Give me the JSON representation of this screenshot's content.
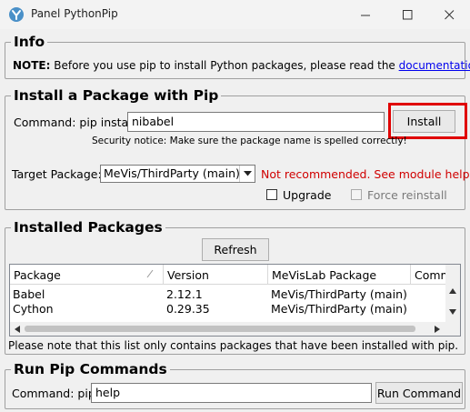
{
  "window": {
    "title": "Panel PythonPip",
    "minimize_icon": "minimize-icon",
    "maximize_icon": "maximize-icon",
    "close_icon": "close-icon"
  },
  "info": {
    "title": "Info",
    "note_label": "NOTE:",
    "note_text": " Before you use pip to install Python packages, please read the ",
    "link_text": "documentation",
    "note_end": "."
  },
  "install": {
    "title": "Install a Package with Pip",
    "command_label": "Command: pip install",
    "command_value": "nibabel",
    "install_button": "Install",
    "security_notice": "Security notice: Make sure the package name is spelled correctly!",
    "target_label": "Target Package:",
    "target_value": "MeVis/ThirdParty (main)",
    "target_warning": "Not recommended. See module help.",
    "upgrade_label": "Upgrade",
    "upgrade_checked": false,
    "force_label": "Force reinstall",
    "force_checked": false,
    "highlight_color": "#e00000",
    "warning_color": "#d00000"
  },
  "installed": {
    "title": "Installed Packages",
    "refresh_button": "Refresh",
    "columns": [
      "Package",
      "Version",
      "MeVisLab Package",
      "Comm"
    ],
    "rows": [
      {
        "package": "Babel",
        "version": "2.12.1",
        "mevislab": "MeVis/ThirdParty (main)"
      },
      {
        "package": "Cython",
        "version": "0.29.35",
        "mevislab": "MeVis/ThirdParty (main)"
      }
    ],
    "footnote": "Please note that this list only contains packages that have been installed with pip."
  },
  "run": {
    "title": "Run Pip Commands",
    "command_label": "Command: pip",
    "command_value": "help",
    "run_button": "Run Command"
  }
}
